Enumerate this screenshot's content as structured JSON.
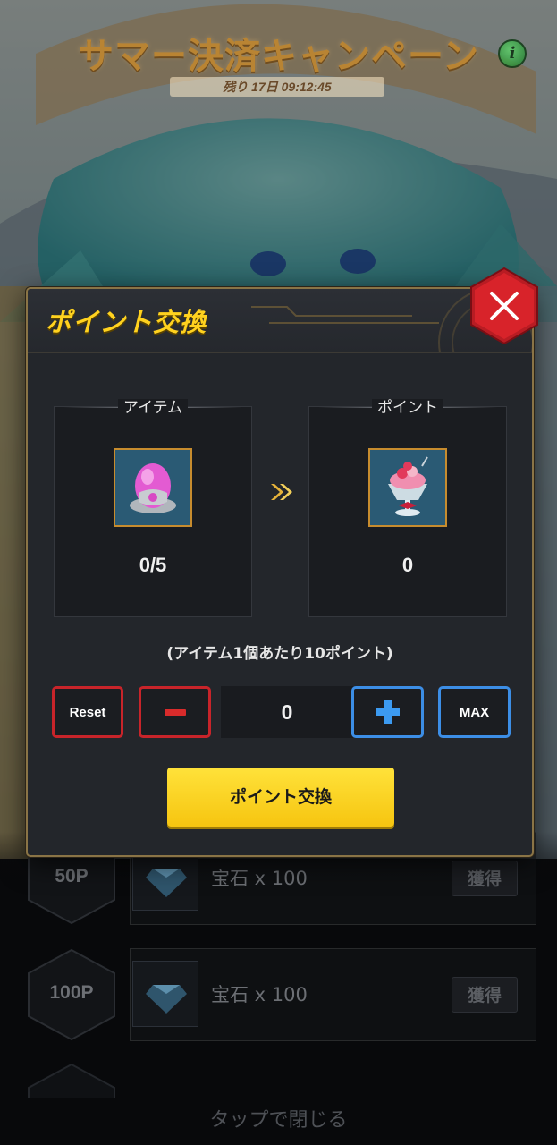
{
  "background": {
    "banner_title": "サマー決済キャンペーン",
    "banner_time": "残り 17日 09:12:45",
    "info_icon": "i",
    "reward_rows": [
      {
        "points": "50P",
        "reward": "宝石 x 100",
        "claim": "獲得"
      },
      {
        "points": "100P",
        "reward": "宝石 x 100",
        "claim": "獲得"
      }
    ],
    "tap_to_close": "タップで閉じる"
  },
  "modal": {
    "title": "ポイント交換",
    "item_panel": {
      "label": "アイテム",
      "count": "0/5",
      "icon": "pink-egg-icon"
    },
    "point_panel": {
      "label": "ポイント",
      "count": "0",
      "icon": "parfait-icon"
    },
    "rate_note": "(アイテム1個あたり10ポイント)",
    "controls": {
      "reset": "Reset",
      "quantity": "0",
      "max": "MAX"
    },
    "exchange_button": "ポイント交換"
  },
  "colors": {
    "accent_gold": "#ffd21f",
    "minus_red": "#c8242a",
    "plus_blue": "#3c8ee6",
    "close_red": "#d8232a"
  }
}
